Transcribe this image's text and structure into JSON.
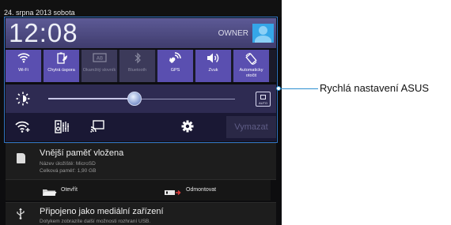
{
  "status_bar": {
    "date": "24. srpna 2013 sobota"
  },
  "quick_settings": {
    "clock": "12:08",
    "user_label": "OWNER",
    "tiles": [
      {
        "label": "Wi-Fi",
        "icon": "wifi-icon",
        "state": "on"
      },
      {
        "label": "Chytrá úspora",
        "icon": "battery-saver-icon",
        "state": "on"
      },
      {
        "label": "Okamžitý slovník",
        "icon": "instant-dictionary-icon",
        "state": "off"
      },
      {
        "label": "Bluetooth",
        "icon": "bluetooth-icon",
        "state": "off"
      },
      {
        "label": "GPS",
        "icon": "gps-icon",
        "state": "on"
      },
      {
        "label": "Zvuk",
        "icon": "sound-icon",
        "state": "on"
      },
      {
        "label": "Automaticky otočit",
        "icon": "auto-rotate-icon",
        "state": "on"
      }
    ],
    "brightness_level": 0.46,
    "brightness_auto_label": "AUTO",
    "clear_label": "Vymazat"
  },
  "notifications": {
    "sd_card": {
      "title": "Vnější paměť vložena",
      "line1": "Název úložiště: MicroSD",
      "line2": "Celková paměť: 1,90 GB",
      "action_open": "Otevřít",
      "action_unmount": "Odmontovat"
    },
    "usb": {
      "title": "Připojeno jako mediální zařízení",
      "subtitle": "Dotykem zobrazíte další možnosti rozhraní USB."
    }
  },
  "callout": {
    "label": "Rychlá nastavení ASUS"
  },
  "colors": {
    "tile_on": "#5a4fb0",
    "tile_off": "#3c3a5a",
    "accent": "#2b8fd0",
    "avatar": "#35a6e8"
  }
}
